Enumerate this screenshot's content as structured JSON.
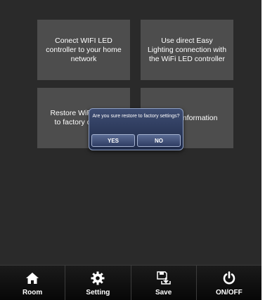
{
  "tiles": [
    {
      "lines": [
        "Conect WIFI LED",
        "controller to your home",
        "network"
      ]
    },
    {
      "lines": [
        "Use direct Easy",
        "Lighting connection with",
        "the WiFi LED controller"
      ]
    },
    {
      "lines": [
        "Restore WiFi factory",
        "to factory defaults"
      ]
    },
    {
      "lines": [
        "Device information"
      ]
    }
  ],
  "dialog": {
    "message": "Are you sure restore to factory settings?",
    "yes_label": "YES",
    "no_label": "NO"
  },
  "nav": [
    {
      "label": "Room",
      "icon": "home-icon"
    },
    {
      "label": "Setting",
      "icon": "gear-icon"
    },
    {
      "label": "Save",
      "icon": "save-icon"
    },
    {
      "label": "ON/OFF",
      "icon": "power-icon"
    }
  ],
  "colors": {
    "background": "#2a2a2a",
    "tile": "#4d4d4d",
    "dialog": "#2b385b",
    "navbar": "#111111"
  }
}
